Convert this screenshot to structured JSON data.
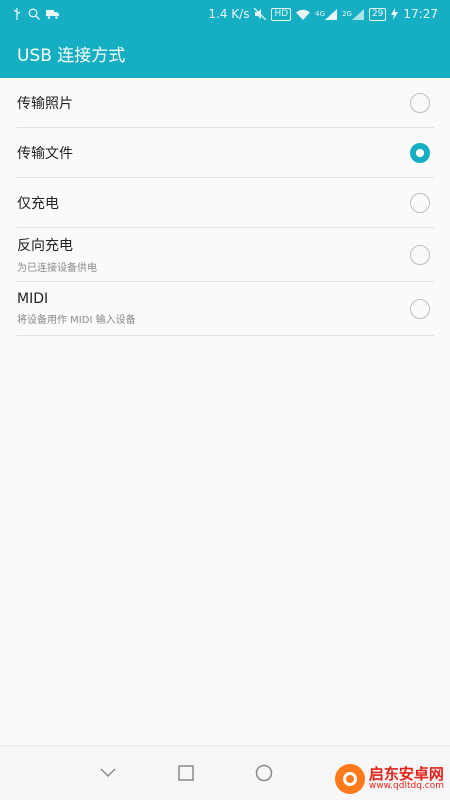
{
  "statusbar": {
    "left_icons": [
      "usb-icon",
      "search-icon",
      "truck-icon"
    ],
    "net_speed": "1.4 K/s",
    "hd_badge": "HD",
    "signal1_label": "4G",
    "signal2_label": "2G",
    "battery_level": "29",
    "time": "17:27"
  },
  "appbar": {
    "title": "USB 连接方式"
  },
  "options": [
    {
      "title": "传输照片",
      "subtitle": "",
      "checked": false
    },
    {
      "title": "传输文件",
      "subtitle": "",
      "checked": true
    },
    {
      "title": "仅充电",
      "subtitle": "",
      "checked": false
    },
    {
      "title": "反向充电",
      "subtitle": "为已连接设备供电",
      "checked": false
    },
    {
      "title": "MIDI",
      "subtitle": "将设备用作 MIDI 输入设备",
      "checked": false
    }
  ],
  "navbar": {
    "buttons": [
      "down-icon",
      "recents-icon",
      "home-icon",
      "back-icon"
    ]
  },
  "watermark": {
    "name": "启东安卓网",
    "url": "www.qdltdq.com"
  },
  "colors": {
    "accent": "#16aec2",
    "background": "#fafafa",
    "divider": "#e2e2e2"
  }
}
